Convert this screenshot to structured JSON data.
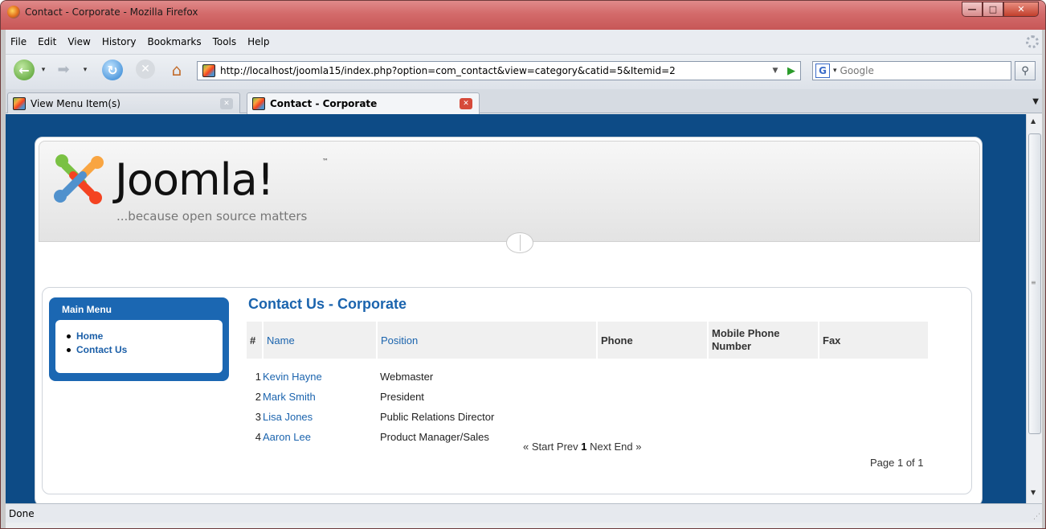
{
  "window": {
    "title": "Contact - Corporate - Mozilla Firefox"
  },
  "menubar": {
    "items": [
      "File",
      "Edit",
      "View",
      "History",
      "Bookmarks",
      "Tools",
      "Help"
    ]
  },
  "navbar": {
    "url": "http://localhost/joomla15/index.php?option=com_contact&view=category&catid=5&Itemid=2",
    "search_placeholder": "Google"
  },
  "tabs": [
    {
      "label": "View Menu Item(s)",
      "active": false
    },
    {
      "label": "Contact - Corporate",
      "active": true
    }
  ],
  "page": {
    "logo_word": "Joomla!",
    "logo_tm": "™",
    "tagline": "...because open source matters",
    "main_menu": {
      "title": "Main Menu",
      "items": [
        "Home",
        "Contact Us"
      ]
    },
    "heading": "Contact Us - Corporate",
    "table": {
      "columns": [
        "#",
        "Name",
        "Position",
        "Phone",
        "Mobile Phone Number",
        "Fax"
      ],
      "rows": [
        {
          "num": "1",
          "name": "Kevin Hayne",
          "position": "Webmaster"
        },
        {
          "num": "2",
          "name": "Mark Smith",
          "position": "President"
        },
        {
          "num": "3",
          "name": "Lisa Jones",
          "position": "Public Relations Director"
        },
        {
          "num": "4",
          "name": "Aaron Lee",
          "position": "Product Manager/Sales"
        }
      ]
    },
    "pagination": {
      "start": "« Start",
      "prev": "Prev",
      "current": "1",
      "next": "Next",
      "end": "End »"
    },
    "page_count": "Page 1 of 1"
  },
  "statusbar": {
    "text": "Done"
  },
  "colors": {
    "title_bar": "#d36a6a",
    "page_background": "#0d4b86",
    "link_blue": "#1b64ae",
    "menu_blue": "#1b67b2"
  }
}
